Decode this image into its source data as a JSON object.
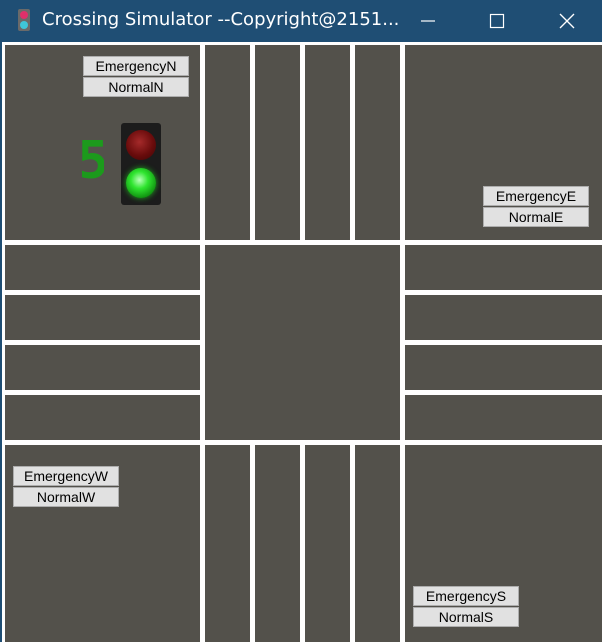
{
  "window": {
    "title": "Crossing Simulator --Copyright@2151...",
    "icon": "traffic-light-icon",
    "controls": [
      "minimize-icon",
      "maximize-icon",
      "close-icon"
    ]
  },
  "controls": {
    "north": {
      "emergency": "EmergencyN",
      "normal": "NormalN"
    },
    "east": {
      "emergency": "EmergencyE",
      "normal": "NormalE"
    },
    "west": {
      "emergency": "EmergencyW",
      "normal": "NormalW"
    },
    "south": {
      "emergency": "EmergencyS",
      "normal": "NormalS"
    }
  },
  "signal": {
    "direction": "north",
    "countdown": "5",
    "active_light": "green",
    "colors": {
      "road": "#53514b",
      "lane_line": "#ffffff",
      "countdown": "#1c9a1c",
      "red_on": "#ff2020",
      "green_on": "#2fe52f"
    }
  }
}
